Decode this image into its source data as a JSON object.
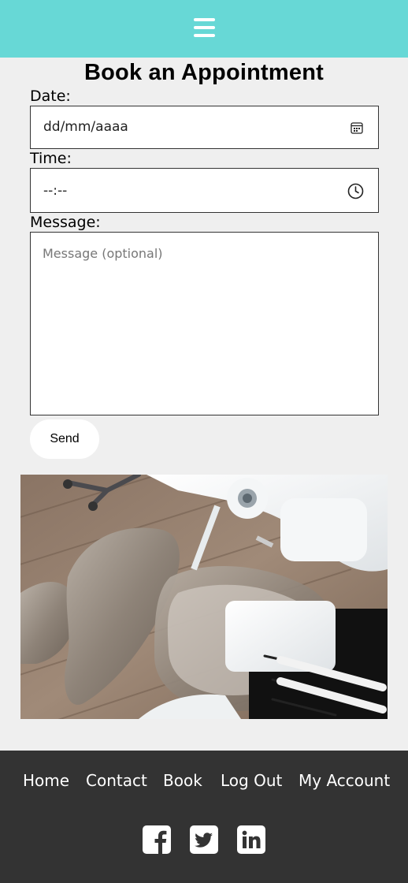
{
  "header": {
    "menu_icon": "hamburger-menu-icon",
    "background_color": "#67d8d6"
  },
  "form": {
    "title": "Book an Appointment",
    "date_label": "Date:",
    "date_value": "dd/mm/aaaa",
    "date_icon": "calendar-icon",
    "time_label": "Time:",
    "time_value": "--:--",
    "time_icon": "clock-icon",
    "message_label": "Message:",
    "message_placeholder": "Message (optional)",
    "send_label": "Send"
  },
  "image": {
    "subject": "dental-chair-photo"
  },
  "footer": {
    "background_color": "#333333",
    "links": [
      "Home",
      "Contact",
      "Book",
      "Log Out",
      "My Account"
    ],
    "social_icons": [
      "facebook-icon",
      "twitter-icon",
      "linkedin-icon"
    ]
  }
}
